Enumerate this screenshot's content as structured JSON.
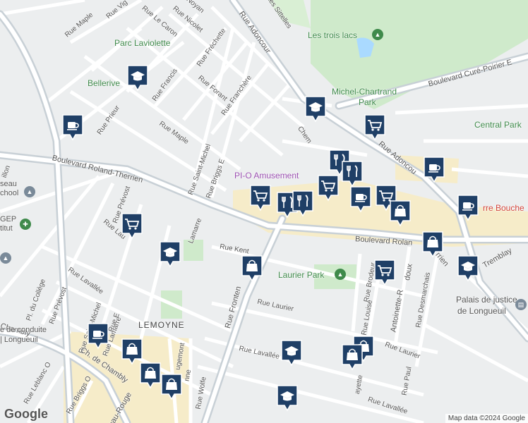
{
  "map": {
    "logo": "Google",
    "attribution": "Map data ©2024 Google",
    "streets": [
      {
        "id": "maple-nw",
        "text": "Rue Maple"
      },
      {
        "id": "vig",
        "text": "Rue Vig"
      },
      {
        "id": "lecaron",
        "text": "Rue Le Caron"
      },
      {
        "id": "nicolet",
        "text": "Rue Nicolet"
      },
      {
        "id": "noyan",
        "text": "Noyan"
      },
      {
        "id": "sittelles",
        "text": "des Sittelles"
      },
      {
        "id": "adoncour-n",
        "text": "Rue Adoncour"
      },
      {
        "id": "frechette",
        "text": "Rue Fréchette"
      },
      {
        "id": "francis",
        "text": "Rue Francis"
      },
      {
        "id": "forant",
        "text": "Rue Forant"
      },
      {
        "id": "franchere",
        "text": "Rue Franchère"
      },
      {
        "id": "prieur",
        "text": "Rue Prieur"
      },
      {
        "id": "maple-c",
        "text": "Rue Maple"
      },
      {
        "id": "saint-michel",
        "text": "Rue Saint-Michel"
      },
      {
        "id": "briggs",
        "text": "Rue Briggs E"
      },
      {
        "id": "chem",
        "text": "Chem"
      },
      {
        "id": "adoncour-s",
        "text": "Rue Adoncou"
      },
      {
        "id": "cure-poirier",
        "text": "Boulevard Curé-Poirier E"
      },
      {
        "id": "roland-therrien-w",
        "text": "Boulevard Roland-Therrien"
      },
      {
        "id": "roland-e",
        "text": "Boulevard Rolan"
      },
      {
        "id": "therrien-e",
        "text": "rrien"
      },
      {
        "id": "prevost-n",
        "text": "Rue Prévost"
      },
      {
        "id": "laurent",
        "text": "Rue Lau"
      },
      {
        "id": "lamarre-n",
        "text": "Lamarre"
      },
      {
        "id": "kent",
        "text": "Rue Kent"
      },
      {
        "id": "fronten",
        "text": "Rue Fronten"
      },
      {
        "id": "brodeur",
        "text": "Rue Brodeur"
      },
      {
        "id": "antoinette",
        "text": "Antoinette-R"
      },
      {
        "id": "doux",
        "text": "doux"
      },
      {
        "id": "desmarchais",
        "text": "Rue Desmarchais"
      },
      {
        "id": "tremblay",
        "text": "Tremblay"
      },
      {
        "id": "lavallee-w",
        "text": "Rue Lavallée"
      },
      {
        "id": "college",
        "text": "Pl. du Collège"
      },
      {
        "id": "prevost-s",
        "text": "Rue Prévost"
      },
      {
        "id": "saint-michel-s",
        "text": "Rue Saint-Michel"
      },
      {
        "id": "lamarre-s",
        "text": "Rue Lamarre"
      },
      {
        "id": "rue-e",
        "text": "Rue E"
      },
      {
        "id": "laurier-c",
        "text": "Rue Laurier"
      },
      {
        "id": "louise",
        "text": "Rue Louise"
      },
      {
        "id": "laurier-e",
        "text": "Rue Laurier"
      },
      {
        "id": "lavallee-c",
        "text": "Rue Lavallée"
      },
      {
        "id": "paul",
        "text": "Rue Paul"
      },
      {
        "id": "chambly",
        "text": "Chambly"
      },
      {
        "id": "chemin-chambly",
        "text": "Ch. de Chambly"
      },
      {
        "id": "leblanc",
        "text": "Rue Leblanc O"
      },
      {
        "id": "briggs-o",
        "text": "Rue Briggs O"
      },
      {
        "id": "beau-rouge",
        "text": "eau-Rouge"
      },
      {
        "id": "ugemont",
        "text": "ugemont"
      },
      {
        "id": "wolfe",
        "text": "Rue Wolfe"
      },
      {
        "id": "nne",
        "text": "nne"
      },
      {
        "id": "ayette",
        "text": "ayette"
      },
      {
        "id": "lavallee-se",
        "text": "Rue Lavallée"
      },
      {
        "id": "villon",
        "text": "illon"
      }
    ],
    "parks": [
      {
        "id": "laviolette",
        "text": "Parc Laviolette"
      },
      {
        "id": "trois-lacs",
        "text": "Les trois lacs"
      },
      {
        "id": "michel-chartrand",
        "text": "Michel-Chartrand"
      },
      {
        "id": "michel-chartrand-2",
        "text": "Park"
      },
      {
        "id": "laurier-park",
        "text": "Laurier Park"
      }
    ],
    "places": [
      {
        "id": "bellerive",
        "text": "Bellerive"
      },
      {
        "id": "central-park",
        "text": "Central Park"
      },
      {
        "id": "palais",
        "text": "Palais de justice"
      },
      {
        "id": "palais-2",
        "text": "de Longueuil"
      },
      {
        "id": "seau",
        "text": "seau"
      },
      {
        "id": "school",
        "text": "chool"
      },
      {
        "id": "cegep",
        "text": "GEP"
      },
      {
        "id": "titut",
        "text": "titut"
      },
      {
        "id": "conduite",
        "text": "e de conduite"
      },
      {
        "id": "longueuil",
        "text": "| Longueuil"
      }
    ],
    "poi_purple": {
      "text": "PI-O Amusement"
    },
    "poi_red": {
      "text": "rre Bouche"
    },
    "neighborhood": {
      "text": "LEMOYNE"
    },
    "markers": [
      {
        "id": "m1",
        "icon": "school-icon"
      },
      {
        "id": "m2",
        "icon": "cafe-icon"
      },
      {
        "id": "m3",
        "icon": "school-icon"
      },
      {
        "id": "m4",
        "icon": "grocery-cart-icon"
      },
      {
        "id": "m5",
        "icon": "restaurant-icon"
      },
      {
        "id": "m6",
        "icon": "cafe-icon"
      },
      {
        "id": "m7",
        "icon": "restaurant-icon"
      },
      {
        "id": "m8",
        "icon": "grocery-cart-icon"
      },
      {
        "id": "m9",
        "icon": "grocery-cart-icon"
      },
      {
        "id": "m10",
        "icon": "restaurant-icon"
      },
      {
        "id": "m11",
        "icon": "cafe-icon"
      },
      {
        "id": "m12",
        "icon": "grocery-cart-icon"
      },
      {
        "id": "m13",
        "icon": "shopping-bag-icon"
      },
      {
        "id": "m14",
        "icon": "cafe-icon"
      },
      {
        "id": "m15",
        "icon": "grocery-cart-icon"
      },
      {
        "id": "m16",
        "icon": "school-icon"
      },
      {
        "id": "m17",
        "icon": "shopping-bag-icon"
      },
      {
        "id": "m18",
        "icon": "shopping-bag-icon"
      },
      {
        "id": "m19",
        "icon": "grocery-cart-icon"
      },
      {
        "id": "m20",
        "icon": "school-icon"
      },
      {
        "id": "m21",
        "icon": "cafe-icon"
      },
      {
        "id": "m22",
        "icon": "shopping-bag-icon"
      },
      {
        "id": "m23",
        "icon": "shopping-bag-icon"
      },
      {
        "id": "m24",
        "icon": "shopping-bag-icon"
      },
      {
        "id": "m25",
        "icon": "school-icon"
      },
      {
        "id": "m26",
        "icon": "shopping-bag-icon"
      },
      {
        "id": "m27",
        "icon": "school-icon"
      },
      {
        "id": "m28",
        "icon": "shopping-bag-icon"
      },
      {
        "id": "m29",
        "icon": "restaurant-icon"
      }
    ],
    "colors": {
      "marker": "#1f3f66",
      "park": "#cdebc7",
      "road": "#ffffff",
      "highway": "#c3ccd3",
      "commercial": "#f5ebc9"
    }
  }
}
